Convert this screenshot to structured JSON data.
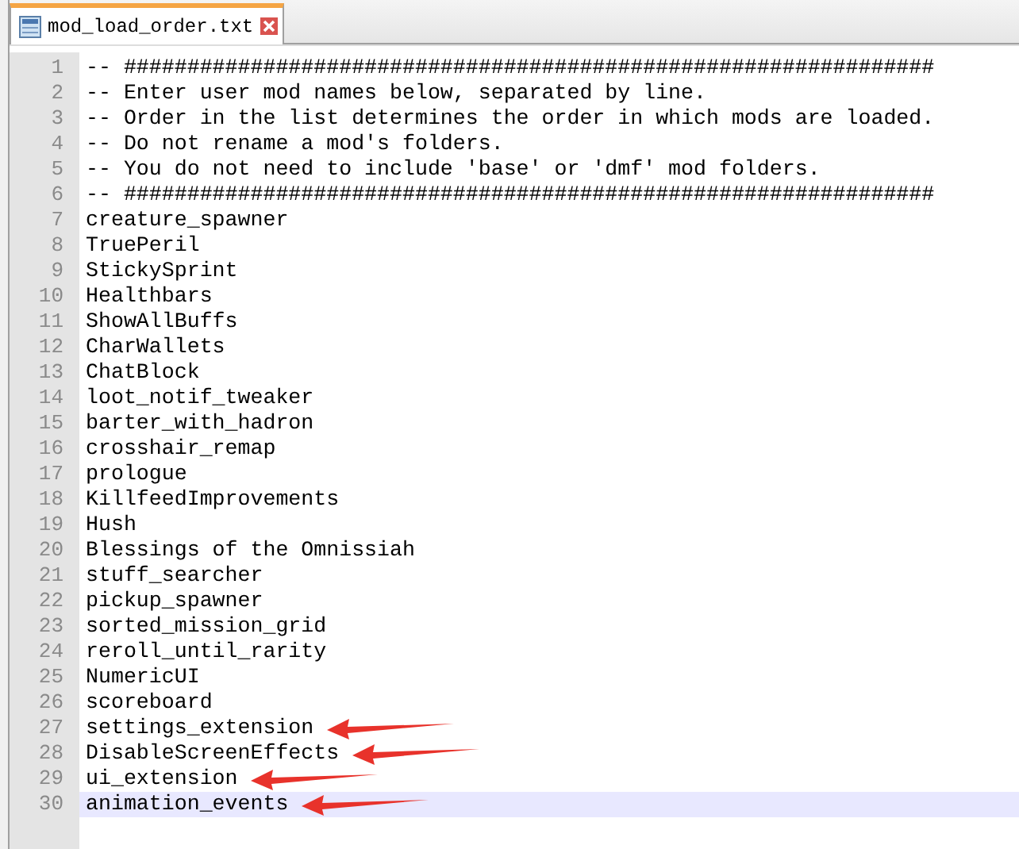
{
  "tabs": [
    {
      "label": "mod_load_order.txt",
      "selected": true
    }
  ],
  "lines": [
    {
      "number": "1",
      "text": "-- ################################################################",
      "current": false,
      "annotated": false
    },
    {
      "number": "2",
      "text": "-- Enter user mod names below, separated by line.",
      "current": false,
      "annotated": false
    },
    {
      "number": "3",
      "text": "-- Order in the list determines the order in which mods are loaded.",
      "current": false,
      "annotated": false
    },
    {
      "number": "4",
      "text": "-- Do not rename a mod's folders.",
      "current": false,
      "annotated": false
    },
    {
      "number": "5",
      "text": "-- You do not need to include 'base' or 'dmf' mod folders.",
      "current": false,
      "annotated": false
    },
    {
      "number": "6",
      "text": "-- ################################################################",
      "current": false,
      "annotated": false
    },
    {
      "number": "7",
      "text": "creature_spawner",
      "current": false,
      "annotated": false
    },
    {
      "number": "8",
      "text": "TruePeril",
      "current": false,
      "annotated": false
    },
    {
      "number": "9",
      "text": "StickySprint",
      "current": false,
      "annotated": false
    },
    {
      "number": "10",
      "text": "Healthbars",
      "current": false,
      "annotated": false
    },
    {
      "number": "11",
      "text": "ShowAllBuffs",
      "current": false,
      "annotated": false
    },
    {
      "number": "12",
      "text": "CharWallets",
      "current": false,
      "annotated": false
    },
    {
      "number": "13",
      "text": "ChatBlock",
      "current": false,
      "annotated": false
    },
    {
      "number": "14",
      "text": "loot_notif_tweaker",
      "current": false,
      "annotated": false
    },
    {
      "number": "15",
      "text": "barter_with_hadron",
      "current": false,
      "annotated": false
    },
    {
      "number": "16",
      "text": "crosshair_remap",
      "current": false,
      "annotated": false
    },
    {
      "number": "17",
      "text": "prologue",
      "current": false,
      "annotated": false
    },
    {
      "number": "18",
      "text": "KillfeedImprovements",
      "current": false,
      "annotated": false
    },
    {
      "number": "19",
      "text": "Hush",
      "current": false,
      "annotated": false
    },
    {
      "number": "20",
      "text": "Blessings of the Omnissiah",
      "current": false,
      "annotated": false
    },
    {
      "number": "21",
      "text": "stuff_searcher",
      "current": false,
      "annotated": false
    },
    {
      "number": "22",
      "text": "pickup_spawner",
      "current": false,
      "annotated": false
    },
    {
      "number": "23",
      "text": "sorted_mission_grid",
      "current": false,
      "annotated": false
    },
    {
      "number": "24",
      "text": "reroll_until_rarity",
      "current": false,
      "annotated": false
    },
    {
      "number": "25",
      "text": "NumericUI",
      "current": false,
      "annotated": false
    },
    {
      "number": "26",
      "text": "scoreboard",
      "current": false,
      "annotated": false
    },
    {
      "number": "27",
      "text": "settings_extension",
      "current": false,
      "annotated": true
    },
    {
      "number": "28",
      "text": "DisableScreenEffects",
      "current": false,
      "annotated": true
    },
    {
      "number": "29",
      "text": "ui_extension",
      "current": false,
      "annotated": true
    },
    {
      "number": "30",
      "text": "animation_events",
      "current": true,
      "annotated": true
    }
  ]
}
